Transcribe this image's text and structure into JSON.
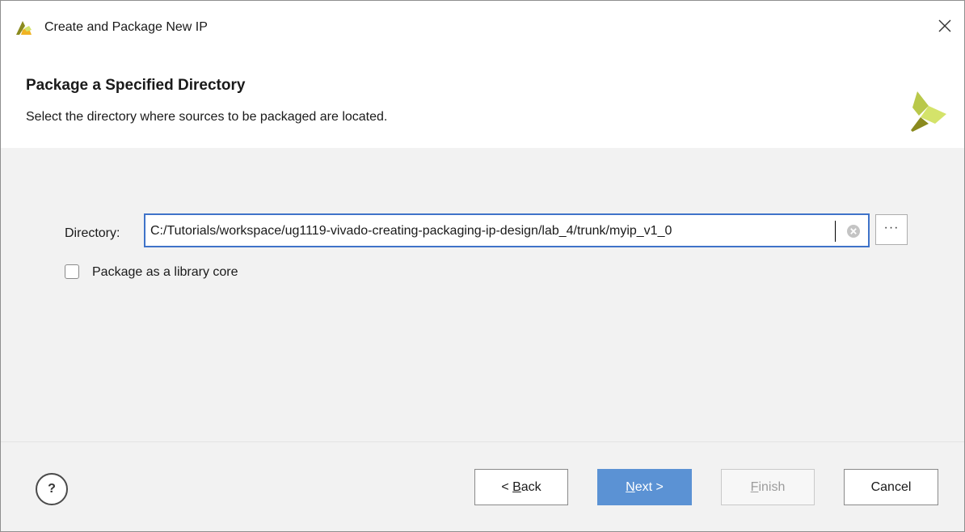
{
  "window": {
    "title": "Create and Package New IP"
  },
  "header": {
    "heading": "Package a Specified Directory",
    "subheading": "Select the directory where sources to be packaged are located."
  },
  "form": {
    "directory_label": "Directory:",
    "directory_value": "C:/Tutorials/workspace/ug1119-vivado-creating-packaging-ip-design/lab_4/trunk/myip_v1_0",
    "browse_label": "···",
    "library_core_label": "Package as a library core",
    "library_core_checked": false
  },
  "footer": {
    "help_label": "?",
    "back": {
      "prefix": "< ",
      "mnemonic": "B",
      "rest": "ack"
    },
    "next": {
      "mnemonic": "N",
      "rest": "ext >"
    },
    "finish": {
      "mnemonic": "F",
      "rest": "inish"
    },
    "cancel_label": "Cancel"
  },
  "colors": {
    "accent_blue": "#3f73c9",
    "primary_button": "#5b92d4",
    "logo_dark": "#8a8a1e",
    "logo_light": "#d4e36a"
  },
  "icons": {
    "app_icon": "vivado-logo-icon",
    "close_icon": "close-icon",
    "brand_logo": "vivado-logo-icon",
    "clear_icon": "clear-circle-icon",
    "help_icon": "help-icon"
  }
}
